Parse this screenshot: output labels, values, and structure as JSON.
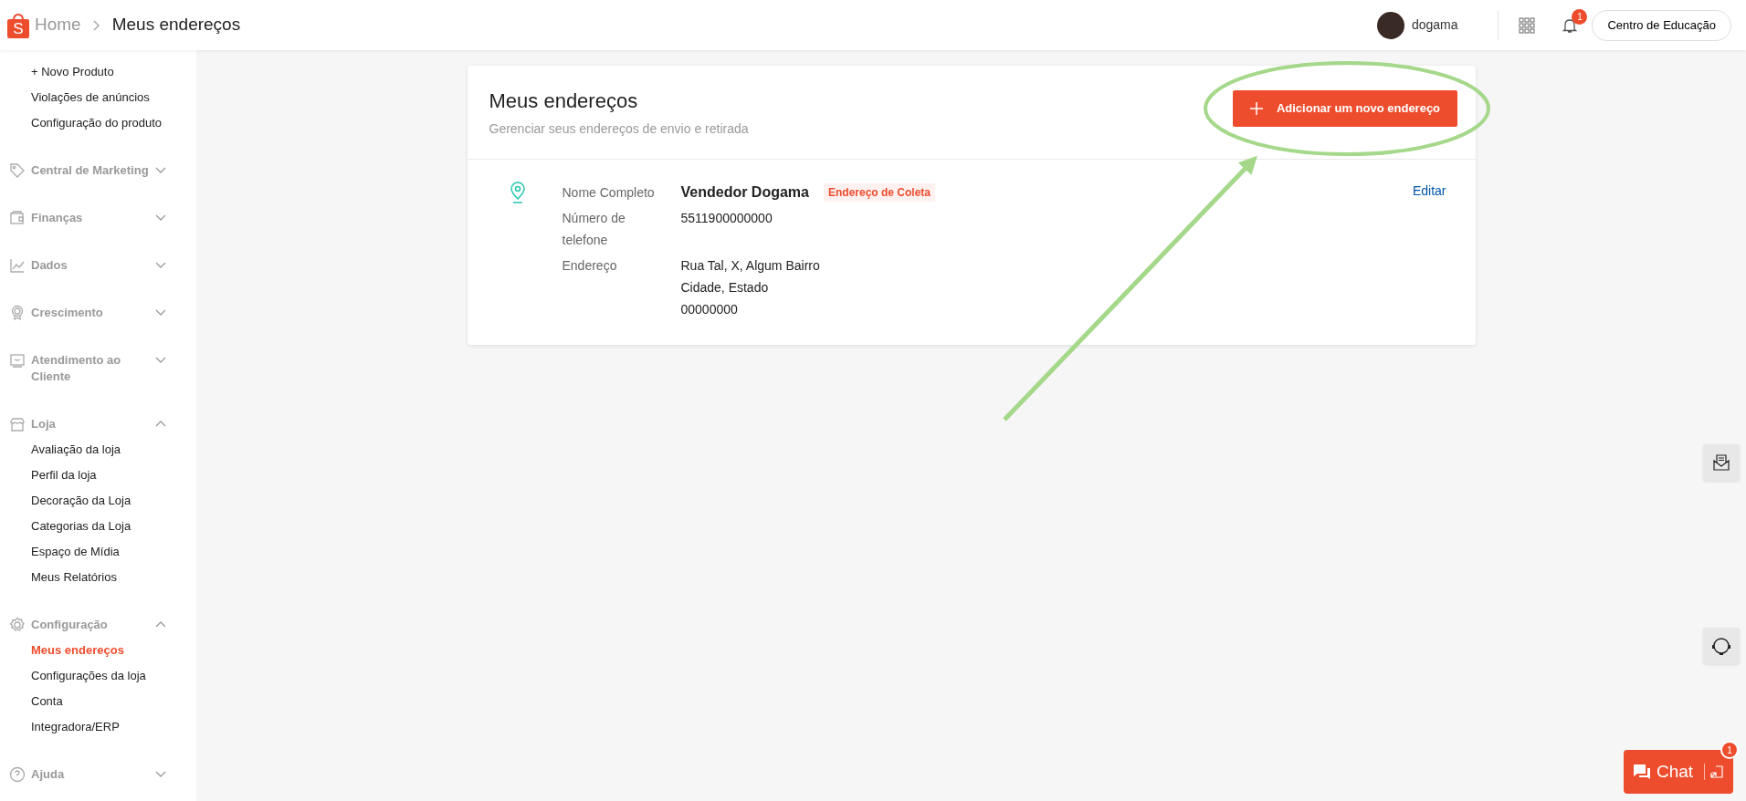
{
  "header": {
    "logo_letter": "S",
    "breadcrumb": [
      {
        "label": "Home",
        "current": false
      },
      {
        "label": "Meus endereços",
        "current": true
      }
    ],
    "user": {
      "name": "dogama"
    },
    "notifications": {
      "count": "1"
    },
    "education_button": "Centro de Educação"
  },
  "sidebar": {
    "loose_items": [
      {
        "label": "+ Novo Produto",
        "selected": false
      },
      {
        "label": "Violações de anúncios",
        "selected": false
      },
      {
        "label": "Configuração do produto",
        "selected": false
      }
    ],
    "sections": [
      {
        "label": "Central de Marketing",
        "expanded": false
      },
      {
        "label": "Finanças",
        "expanded": false
      },
      {
        "label": "Dados",
        "expanded": false
      },
      {
        "label": "Crescimento",
        "expanded": false
      },
      {
        "label": "Atendimento ao Cliente",
        "expanded": false
      },
      {
        "label": "Loja",
        "expanded": true,
        "children": [
          {
            "label": "Avaliação da loja",
            "selected": false
          },
          {
            "label": "Perfil da loja",
            "selected": false
          },
          {
            "label": "Decoração da Loja",
            "selected": false
          },
          {
            "label": "Categorias da Loja",
            "selected": false
          },
          {
            "label": "Espaço de Mídia",
            "selected": false
          },
          {
            "label": "Meus Relatórios",
            "selected": false
          }
        ]
      },
      {
        "label": "Configuração",
        "expanded": true,
        "children": [
          {
            "label": "Meus endereços",
            "selected": true
          },
          {
            "label": "Configurações da loja",
            "selected": false
          },
          {
            "label": "Conta",
            "selected": false
          },
          {
            "label": "Integradora/ERP",
            "selected": false
          }
        ]
      },
      {
        "label": "Ajuda",
        "expanded": false
      }
    ]
  },
  "card": {
    "title": "Meus endereços",
    "subtitle": "Gerenciar seus endereços de envio e retirada",
    "add_button": "Adicionar um novo endereço",
    "addresses": [
      {
        "name_label": "Nome Completo",
        "name": "Vendedor Dogama",
        "tag": "Endereço de Coleta",
        "phone_label": "Número de telefone",
        "phone": "5511900000000",
        "address_label": "Endereço",
        "address_lines": [
          "Rua Tal, X, Algum Bairro",
          "Cidade, Estado",
          "00000000"
        ],
        "edit": "Editar"
      }
    ]
  },
  "chat": {
    "label": "Chat",
    "badge": "1"
  }
}
